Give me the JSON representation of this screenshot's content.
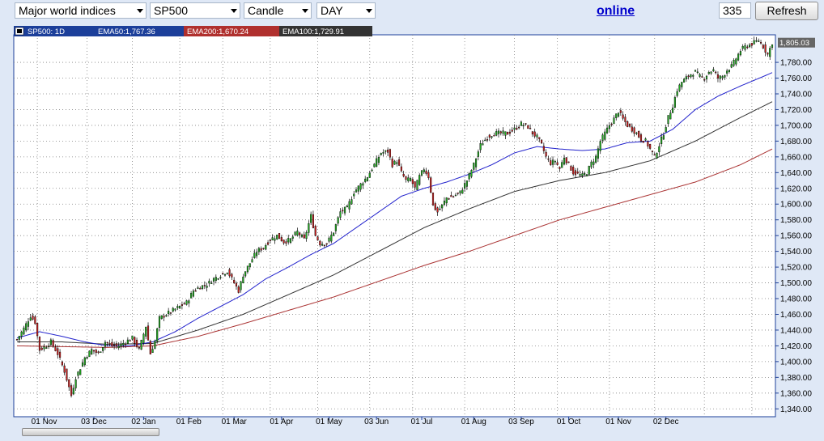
{
  "toolbar": {
    "market_select": "Major world indices",
    "symbol_select": "SP500",
    "chart_type_select": "Candle",
    "period_select": "DAY",
    "online_link": "online",
    "bar_count": "335",
    "refresh_label": "Refresh"
  },
  "legend": {
    "series_label": "SP500: 1D",
    "ema50_label": "EMA50:1,767.36",
    "ema200_label": "EMA200:1,670.24",
    "ema100_label": "EMA100:1,729.91"
  },
  "price_tag": "1,805.03",
  "chart_data": {
    "type": "candlestick",
    "symbol": "SP500",
    "interval": "1D",
    "ylim": [
      1330,
      1815
    ],
    "y_ticks": [
      1340,
      1360,
      1380,
      1400,
      1420,
      1440,
      1460,
      1480,
      1500,
      1520,
      1540,
      1560,
      1580,
      1600,
      1620,
      1640,
      1660,
      1680,
      1700,
      1720,
      1740,
      1760,
      1780
    ],
    "x_ticks": [
      "01 Nov",
      "03 Dec",
      "02 Jan",
      "01 Feb",
      "01 Mar",
      "01 Apr",
      "01 May",
      "03 Jun",
      "01 Jul",
      "01 Aug",
      "03 Sep",
      "01 Oct",
      "01 Nov",
      "02 Dec"
    ],
    "grid": true,
    "last_price": 1805.03,
    "close_anchors": [
      [
        0,
        1428
      ],
      [
        3,
        1442
      ],
      [
        6,
        1458
      ],
      [
        8,
        1450
      ],
      [
        10,
        1415
      ],
      [
        13,
        1420
      ],
      [
        15,
        1425
      ],
      [
        18,
        1410
      ],
      [
        21,
        1388
      ],
      [
        24,
        1357
      ],
      [
        26,
        1380
      ],
      [
        28,
        1392
      ],
      [
        30,
        1405
      ],
      [
        33,
        1415
      ],
      [
        36,
        1410
      ],
      [
        39,
        1425
      ],
      [
        42,
        1420
      ],
      [
        45,
        1420
      ],
      [
        48,
        1425
      ],
      [
        51,
        1430
      ],
      [
        54,
        1415
      ],
      [
        57,
        1445
      ],
      [
        59,
        1410
      ],
      [
        61,
        1426
      ],
      [
        63,
        1455
      ],
      [
        66,
        1460
      ],
      [
        69,
        1465
      ],
      [
        72,
        1470
      ],
      [
        75,
        1475
      ],
      [
        78,
        1490
      ],
      [
        81,
        1495
      ],
      [
        84,
        1498
      ],
      [
        87,
        1505
      ],
      [
        90,
        1510
      ],
      [
        93,
        1515
      ],
      [
        96,
        1500
      ],
      [
        98,
        1490
      ],
      [
        100,
        1510
      ],
      [
        103,
        1525
      ],
      [
        106,
        1540
      ],
      [
        109,
        1545
      ],
      [
        112,
        1555
      ],
      [
        115,
        1560
      ],
      [
        118,
        1552
      ],
      [
        121,
        1555
      ],
      [
        124,
        1565
      ],
      [
        127,
        1555
      ],
      [
        130,
        1585
      ],
      [
        132,
        1560
      ],
      [
        134,
        1550
      ],
      [
        137,
        1550
      ],
      [
        140,
        1565
      ],
      [
        143,
        1590
      ],
      [
        146,
        1595
      ],
      [
        149,
        1615
      ],
      [
        152,
        1625
      ],
      [
        155,
        1635
      ],
      [
        158,
        1650
      ],
      [
        161,
        1665
      ],
      [
        164,
        1667
      ],
      [
        166,
        1650
      ],
      [
        168,
        1655
      ],
      [
        170,
        1640
      ],
      [
        172,
        1630
      ],
      [
        174,
        1632
      ],
      [
        176,
        1620
      ],
      [
        178,
        1635
      ],
      [
        180,
        1645
      ],
      [
        182,
        1635
      ],
      [
        184,
        1598
      ],
      [
        186,
        1590
      ],
      [
        188,
        1598
      ],
      [
        190,
        1608
      ],
      [
        193,
        1610
      ],
      [
        196,
        1615
      ],
      [
        199,
        1630
      ],
      [
        202,
        1650
      ],
      [
        205,
        1675
      ],
      [
        208,
        1685
      ],
      [
        211,
        1690
      ],
      [
        214,
        1690
      ],
      [
        217,
        1690
      ],
      [
        220,
        1695
      ],
      [
        223,
        1702
      ],
      [
        226,
        1698
      ],
      [
        228,
        1690
      ],
      [
        230,
        1685
      ],
      [
        232,
        1675
      ],
      [
        234,
        1660
      ],
      [
        236,
        1652
      ],
      [
        238,
        1655
      ],
      [
        240,
        1645
      ],
      [
        242,
        1660
      ],
      [
        244,
        1650
      ],
      [
        246,
        1640
      ],
      [
        248,
        1638
      ],
      [
        250,
        1636
      ],
      [
        252,
        1640
      ],
      [
        254,
        1652
      ],
      [
        256,
        1660
      ],
      [
        258,
        1680
      ],
      [
        260,
        1690
      ],
      [
        262,
        1700
      ],
      [
        264,
        1708
      ],
      [
        266,
        1718
      ],
      [
        268,
        1708
      ],
      [
        270,
        1700
      ],
      [
        272,
        1695
      ],
      [
        274,
        1690
      ],
      [
        276,
        1682
      ],
      [
        278,
        1680
      ],
      [
        280,
        1670
      ],
      [
        282,
        1660
      ],
      [
        284,
        1675
      ],
      [
        286,
        1690
      ],
      [
        288,
        1710
      ],
      [
        290,
        1725
      ],
      [
        292,
        1745
      ],
      [
        294,
        1755
      ],
      [
        296,
        1760
      ],
      [
        298,
        1765
      ],
      [
        300,
        1768
      ],
      [
        302,
        1762
      ],
      [
        304,
        1760
      ],
      [
        306,
        1768
      ],
      [
        308,
        1770
      ],
      [
        310,
        1760
      ],
      [
        312,
        1762
      ],
      [
        314,
        1770
      ],
      [
        316,
        1775
      ],
      [
        318,
        1785
      ],
      [
        320,
        1795
      ],
      [
        322,
        1800
      ],
      [
        324,
        1802
      ],
      [
        326,
        1805
      ],
      [
        328,
        1808
      ],
      [
        330,
        1800
      ],
      [
        332,
        1790
      ],
      [
        334,
        1805
      ]
    ],
    "ema50_anchors": [
      [
        0,
        1430
      ],
      [
        10,
        1438
      ],
      [
        20,
        1432
      ],
      [
        30,
        1425
      ],
      [
        40,
        1420
      ],
      [
        50,
        1420
      ],
      [
        60,
        1425
      ],
      [
        70,
        1438
      ],
      [
        80,
        1455
      ],
      [
        90,
        1470
      ],
      [
        100,
        1485
      ],
      [
        110,
        1505
      ],
      [
        120,
        1520
      ],
      [
        130,
        1536
      ],
      [
        140,
        1550
      ],
      [
        150,
        1570
      ],
      [
        160,
        1590
      ],
      [
        170,
        1610
      ],
      [
        180,
        1620
      ],
      [
        190,
        1628
      ],
      [
        200,
        1638
      ],
      [
        210,
        1650
      ],
      [
        220,
        1665
      ],
      [
        230,
        1673
      ],
      [
        240,
        1670
      ],
      [
        250,
        1668
      ],
      [
        260,
        1670
      ],
      [
        270,
        1678
      ],
      [
        280,
        1680
      ],
      [
        290,
        1695
      ],
      [
        300,
        1720
      ],
      [
        310,
        1737
      ],
      [
        320,
        1750
      ],
      [
        330,
        1762
      ],
      [
        334,
        1767
      ]
    ],
    "ema100_anchors": [
      [
        0,
        1425
      ],
      [
        20,
        1425
      ],
      [
        40,
        1422
      ],
      [
        60,
        1423
      ],
      [
        80,
        1440
      ],
      [
        100,
        1460
      ],
      [
        120,
        1485
      ],
      [
        140,
        1510
      ],
      [
        160,
        1540
      ],
      [
        180,
        1570
      ],
      [
        200,
        1594
      ],
      [
        220,
        1616
      ],
      [
        240,
        1630
      ],
      [
        260,
        1640
      ],
      [
        280,
        1655
      ],
      [
        300,
        1680
      ],
      [
        320,
        1710
      ],
      [
        334,
        1730
      ]
    ],
    "ema200_anchors": [
      [
        0,
        1420
      ],
      [
        40,
        1418
      ],
      [
        60,
        1420
      ],
      [
        80,
        1432
      ],
      [
        100,
        1448
      ],
      [
        120,
        1465
      ],
      [
        140,
        1482
      ],
      [
        160,
        1502
      ],
      [
        180,
        1522
      ],
      [
        200,
        1540
      ],
      [
        220,
        1560
      ],
      [
        240,
        1580
      ],
      [
        260,
        1596
      ],
      [
        280,
        1612
      ],
      [
        300,
        1628
      ],
      [
        320,
        1650
      ],
      [
        334,
        1670
      ]
    ],
    "series_colors": {
      "up": "#22aa22",
      "down": "#cc2222",
      "ema50": "#2222cc",
      "ema100": "#333333",
      "ema200": "#aa3333"
    }
  }
}
